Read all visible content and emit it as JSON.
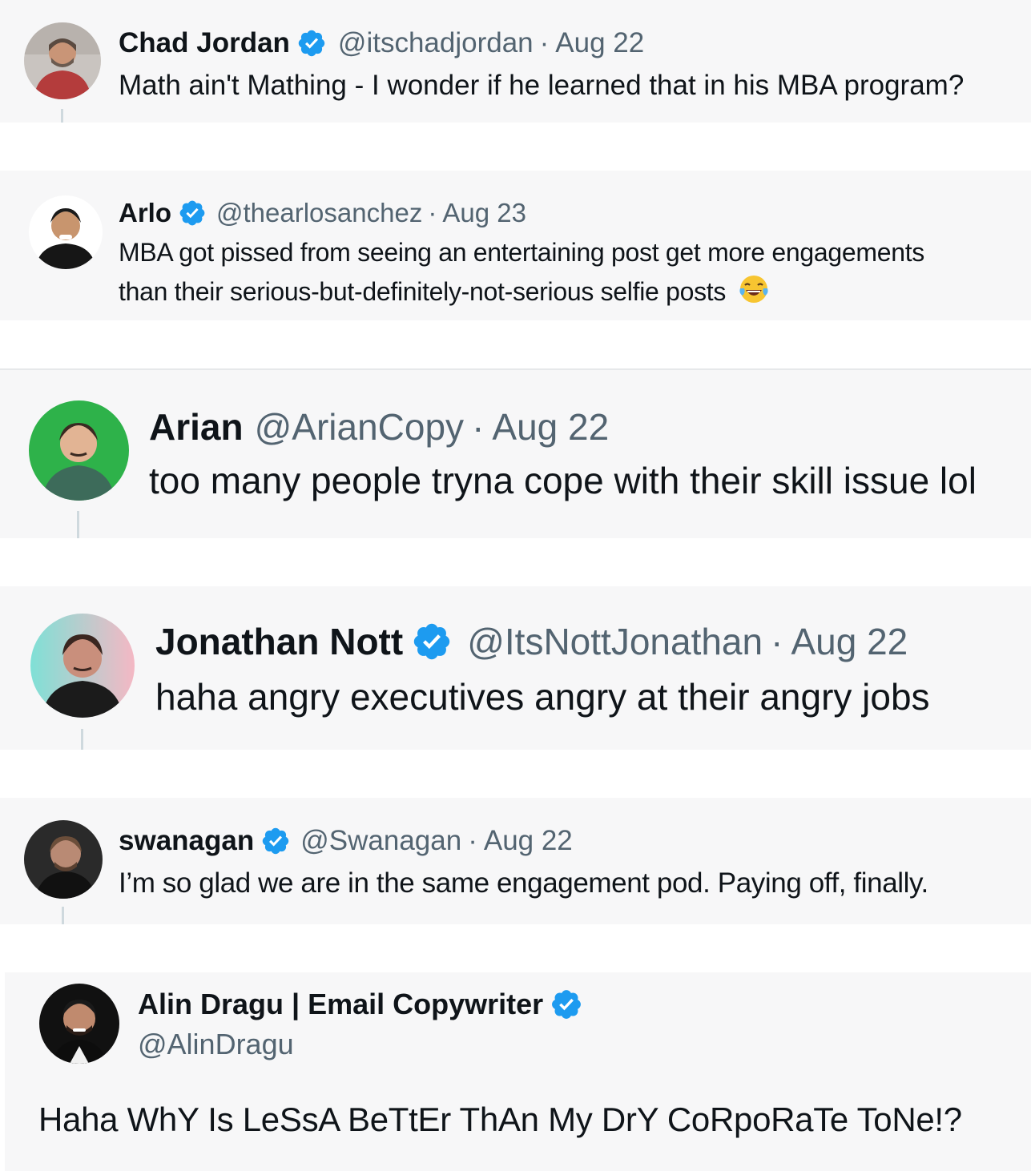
{
  "tweets": [
    {
      "name": "Chad Jordan",
      "verified": true,
      "handle": "@itschadjordan",
      "date": "Aug 22",
      "text": "Math ain't Mathing - I wonder if he learned that in his MBA program?"
    },
    {
      "name": "Arlo",
      "verified": true,
      "handle": "@thearlosanchez",
      "date": "Aug 23",
      "text_line1": "MBA got pissed from seeing an entertaining post get more engagements",
      "text_line2": "than their serious-but-definitely-not-serious selfie posts",
      "emoji": "😂"
    },
    {
      "name": "Arian",
      "verified": false,
      "handle": "@ArianCopy",
      "date": "Aug 22",
      "text": "too many people tryna cope with their skill issue lol"
    },
    {
      "name": "Jonathan Nott",
      "verified": true,
      "handle": "@ItsNottJonathan",
      "date": "Aug 22",
      "text": "haha angry executives angry at their angry jobs"
    },
    {
      "name": "swanagan",
      "verified": true,
      "handle": "@Swanagan",
      "date": "Aug 22",
      "text": "I’m so glad we are in the same engagement pod. Paying off, finally."
    },
    {
      "name": "Alin Dragu | Email Copywriter",
      "verified": true,
      "handle": "@AlinDragu",
      "text": "Haha WhY Is LeSsA BeTtEr ThAn My DrY CoRpoRaTe ToNe!?"
    }
  ],
  "separator": "·",
  "colors": {
    "verified_badge": "#1d9bf0",
    "handle_gray": "#536471",
    "card_bg": "#f7f7f8",
    "thread_line": "#cfd9de"
  }
}
